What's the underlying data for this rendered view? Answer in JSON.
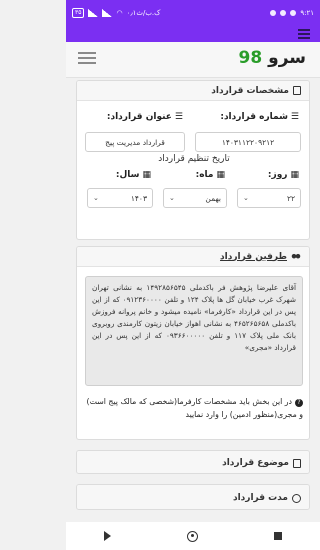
{
  "statusbar": {
    "time": "۹:۲۱",
    "network_speed": "۰٫۱ک.ب/ث",
    "battery": "۳۵"
  },
  "app": {
    "logo_text": "سرو",
    "logo_number": "98"
  },
  "contract_details": {
    "title": "مشخصات قرارداد",
    "number_label": "شماره قرارداد:",
    "number_value": "۱۴۰۳۱۱۲۲۰۹۲۱۲",
    "subject_label": "عنوان قرارداد:",
    "subject_value": "قرارداد مدیریت پیج",
    "date_section_title": "تاریخ تنظیم قرارداد",
    "day_label": "روز:",
    "day_value": "۲۲",
    "month_label": "ماه:",
    "month_value": "بهمن",
    "year_label": "سال:",
    "year_value": "۱۴۰۳"
  },
  "parties": {
    "title": "طرفین قرارداد",
    "text": "آقای علیرضا پژوهش فر باکدملی ۱۴۹۲۸۵۶۵۴۵ به نشانی تهران شهرک غرب خیابان گل ها پلاک ۱۲۴ و تلفن ۰۹۱۲۳۶۰۰۰۰ که از این پس در این قرارداد «کارفرما» نامیده میشود و خانم پروانه فروزش باکدملی ۴۶۵۲۶۵۶۵۸ به نشانی اهواز خیابان زیتون کارمندی روبروی بانک ملی پلاک ۱۱۷ و تلفن ۰۹۳۶۶۰۰۰۰۰ که از این پس در این قرارداد «مجری»",
    "help": "در این بخش باید مشخصات کارفرما(شخصی که مالک پیج است) و مجری(منظور ادمین) را وارد نمایید"
  },
  "contract_subject": {
    "title": "موضوع قرارداد"
  },
  "contract_duration": {
    "title": "مدت قرارداد"
  },
  "icons": {
    "hamburger": "hamburger-icon",
    "book": "book-icon",
    "calendar": "calendar-icon",
    "users": "users-icon",
    "help": "question-icon",
    "clock": "clock-icon"
  }
}
